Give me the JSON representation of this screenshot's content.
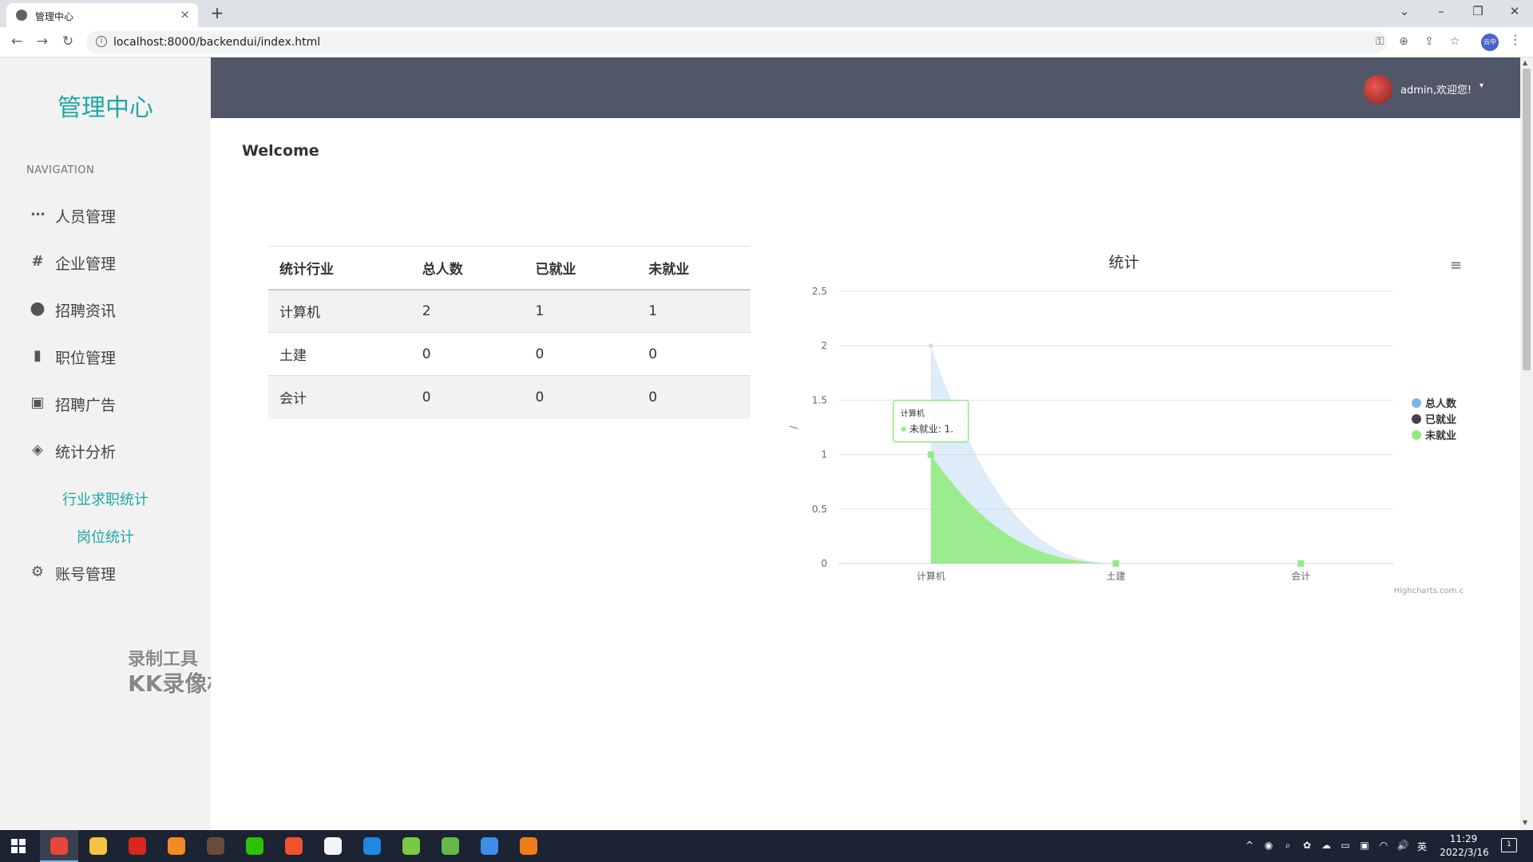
{
  "browser": {
    "tab_title": "管理中心",
    "tab_close": "×",
    "new_tab": "+",
    "url": "localhost:8000/backendui/index.html",
    "window_controls": {
      "dropdown": "⌄",
      "minimize": "–",
      "restore": "❐",
      "close": "✕"
    },
    "nav": {
      "back": "←",
      "forward": "→",
      "reload": "↻"
    },
    "omnibox_icons": {
      "key": "⚿",
      "zoom": "⊕",
      "share": "⇪",
      "star": "☆"
    },
    "profile_label": "云中",
    "menu": "⋮"
  },
  "sidebar": {
    "brand": "管理中心",
    "heading": "NAVIGATION",
    "items": [
      {
        "icon": "more-dots-icon",
        "glyph": "•••",
        "label": "人员管理"
      },
      {
        "icon": "hashtag-icon",
        "glyph": "#",
        "label": "企业管理"
      },
      {
        "icon": "circle-icon",
        "glyph": "●",
        "label": "招聘资讯"
      },
      {
        "icon": "file-icon",
        "glyph": "▮",
        "label": "职位管理"
      },
      {
        "icon": "image-icon",
        "glyph": "▣",
        "label": "招聘广告"
      },
      {
        "icon": "cube-icon",
        "glyph": "◈",
        "label": "统计分析"
      },
      {
        "icon": "gears-icon",
        "glyph": "⚙",
        "label": "账号管理"
      }
    ],
    "sub_items": [
      "行业求职统计",
      "岗位统计"
    ]
  },
  "watermark": {
    "line1": "录制工具",
    "line2": "KK录像机"
  },
  "header": {
    "user": "admin,欢迎您!",
    "caret": "▾"
  },
  "page": {
    "title": "Welcome"
  },
  "table": {
    "headers": [
      "统计行业",
      "总人数",
      "已就业",
      "未就业"
    ],
    "rows": [
      [
        "计算机",
        "2",
        "1",
        "1"
      ],
      [
        "土建",
        "0",
        "0",
        "0"
      ],
      [
        "会计",
        "0",
        "0",
        "0"
      ]
    ]
  },
  "chart_menu": "≡",
  "chart_data": {
    "type": "area",
    "title": "统计",
    "ylabel": "/",
    "categories": [
      "计算机",
      "土建",
      "会计"
    ],
    "ylim": [
      0,
      2.5
    ],
    "yticks": [
      "0",
      "0.5",
      "1",
      "1.5",
      "2",
      "2.5"
    ],
    "grid": true,
    "legend_position": "right",
    "series": [
      {
        "name": "总人数",
        "values": [
          2,
          0,
          0
        ],
        "color": "#7cb5ec"
      },
      {
        "name": "已就业",
        "values": [
          1,
          0,
          0
        ],
        "color": "#434348"
      },
      {
        "name": "未就业",
        "values": [
          1,
          0,
          0
        ],
        "color": "#90ed7d"
      }
    ],
    "tooltip": {
      "category": "计算机",
      "series": "未就业",
      "text": "未就业: 1."
    },
    "credits": "Highcharts.com.c"
  },
  "scrollbar": {
    "up": "▲",
    "down": "▼"
  },
  "taskbar": {
    "apps": [
      {
        "name": "chrome",
        "color": "#e8453c"
      },
      {
        "name": "file-explorer",
        "color": "#f5c242"
      },
      {
        "name": "wps",
        "color": "#d8281d"
      },
      {
        "name": "search-tool",
        "color": "#f08a24"
      },
      {
        "name": "game",
        "color": "#6a4a3a"
      },
      {
        "name": "wechat",
        "color": "#2dc100"
      },
      {
        "name": "video",
        "color": "#f0522c"
      },
      {
        "name": "qq-fox",
        "color": "#f4f4f4"
      },
      {
        "name": "browser-blue",
        "color": "#1e88e5"
      },
      {
        "name": "leaf-app",
        "color": "#7ac943"
      },
      {
        "name": "notepad",
        "color": "#64b947"
      },
      {
        "name": "magnifier",
        "color": "#3d8eea"
      },
      {
        "name": "recorder",
        "color": "#f07c1b"
      }
    ],
    "tray": [
      "^",
      "◉",
      "⌕",
      "✿",
      "☁",
      "▭",
      "▣",
      "◠",
      "🔊",
      "英"
    ],
    "time": "11:29",
    "date": "2022/3/16",
    "notification": "1"
  }
}
